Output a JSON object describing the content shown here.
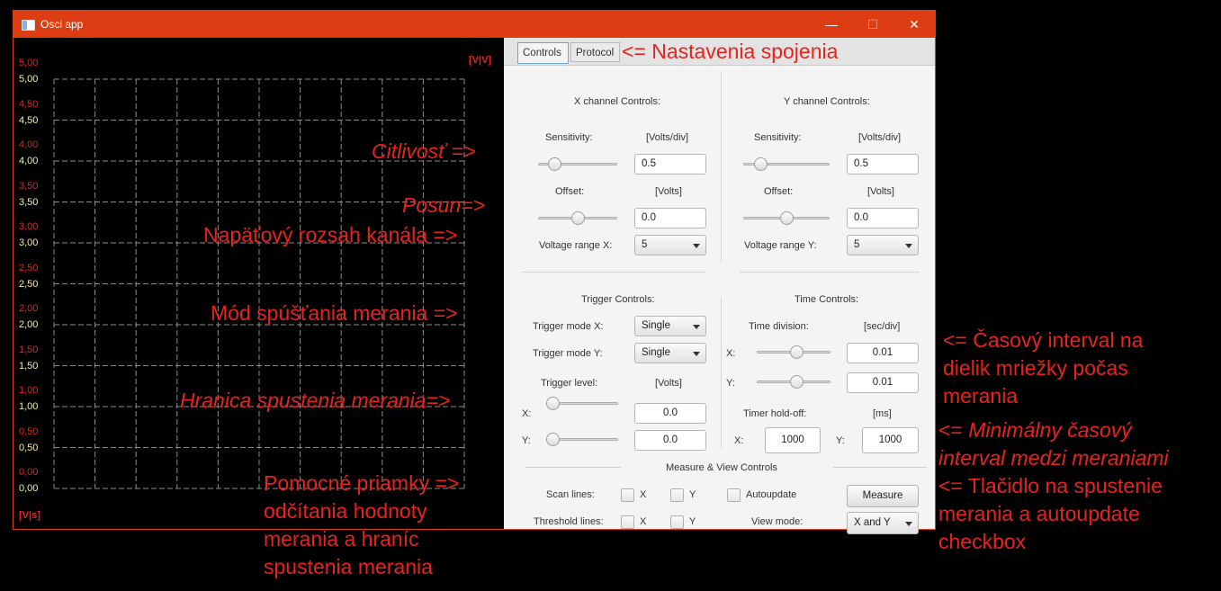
{
  "window": {
    "title": "Osci app",
    "minimize": "—",
    "maximize": "☐",
    "close": "✕"
  },
  "graph": {
    "y_labels_red": [
      "5,00",
      "4,50",
      "4,00",
      "3,50",
      "3,00",
      "2,50",
      "2,00",
      "1,50",
      "1,00",
      "0,50",
      "0,00"
    ],
    "y_labels_yellow": [
      "5,00",
      "4,50",
      "4,00",
      "3,50",
      "3,00",
      "2,50",
      "2,00",
      "1,50",
      "1,00",
      "0,50",
      "0,00"
    ],
    "unit_top": "[V|V]",
    "unit_bottom": "[V|s]"
  },
  "tabs": [
    "Controls",
    "Protocol"
  ],
  "x_channel": {
    "heading": "X channel Controls:",
    "sensitivity_label": "Sensitivity:",
    "sensitivity_unit": "[Volts/div]",
    "sensitivity_value": "0.5",
    "sensitivity_slider": 0.15,
    "offset_label": "Offset:",
    "offset_unit": "[Volts]",
    "offset_value": "0.0",
    "offset_slider": 0.5,
    "range_label": "Voltage range X:",
    "range_value": "5"
  },
  "y_channel": {
    "heading": "Y channel Controls:",
    "sensitivity_label": "Sensitivity:",
    "sensitivity_unit": "[Volts/div]",
    "sensitivity_value": "0.5",
    "sensitivity_slider": 0.15,
    "offset_label": "Offset:",
    "offset_unit": "[Volts]",
    "offset_value": "0.0",
    "offset_slider": 0.5,
    "range_label": "Voltage range Y:",
    "range_value": "5"
  },
  "trigger": {
    "heading": "Trigger Controls:",
    "mode_x_label": "Trigger mode X:",
    "mode_x_value": "Single",
    "mode_y_label": "Trigger mode Y:",
    "mode_y_value": "Single",
    "level_label": "Trigger level:",
    "level_unit": "[Volts]",
    "x_label": "X:",
    "x_value": "0.0",
    "x_slider": 0.0,
    "y_label": "Y:",
    "y_value": "0.0",
    "y_slider": 0.0
  },
  "time": {
    "heading": "Time Controls:",
    "division_label": "Time division:",
    "division_unit": "[sec/div]",
    "x_label": "X:",
    "x_value": "0.01",
    "x_slider": 0.55,
    "y_label": "Y:",
    "y_value": "0.01",
    "y_slider": 0.55,
    "holdoff_label": "Timer hold-off:",
    "holdoff_unit": "[ms]",
    "holdoff_x_label": "X:",
    "holdoff_x_value": "1000",
    "holdoff_y_label": "Y:",
    "holdoff_y_value": "1000"
  },
  "measure": {
    "heading": "Measure & View Controls",
    "scan_lines_label": "Scan lines:",
    "threshold_lines_label": "Threshold lines:",
    "x_label": "X",
    "y_label": "Y",
    "autoupdate_label": "Autoupdate",
    "measure_button": "Measure",
    "view_mode_label": "View mode:",
    "view_mode_value": "X and Y"
  },
  "annotations": {
    "tabs": "<= Nastavenia spojenia",
    "sensitivity": "Citlivosť =>",
    "offset": "Posun=>",
    "range": "Napäťový rozsah kanála =>",
    "trigger_mode": "Mód spúšťania merania =>",
    "trigger_level": "Hranica spustenia merania=>",
    "helper_lines": [
      "Pomocné priamky =>",
      "odčítania hodnoty",
      "merania a hraníc",
      "spustenia merania"
    ],
    "time_division": [
      "<= Časový interval na",
      "dielik mriežky počas",
      "merania"
    ],
    "holdoff": [
      "<= Minimálny časový",
      "interval medzi meraniami"
    ],
    "measure_button": [
      "<= Tlačidlo na spustenie",
      "merania a autoupdate",
      "checkbox"
    ]
  }
}
